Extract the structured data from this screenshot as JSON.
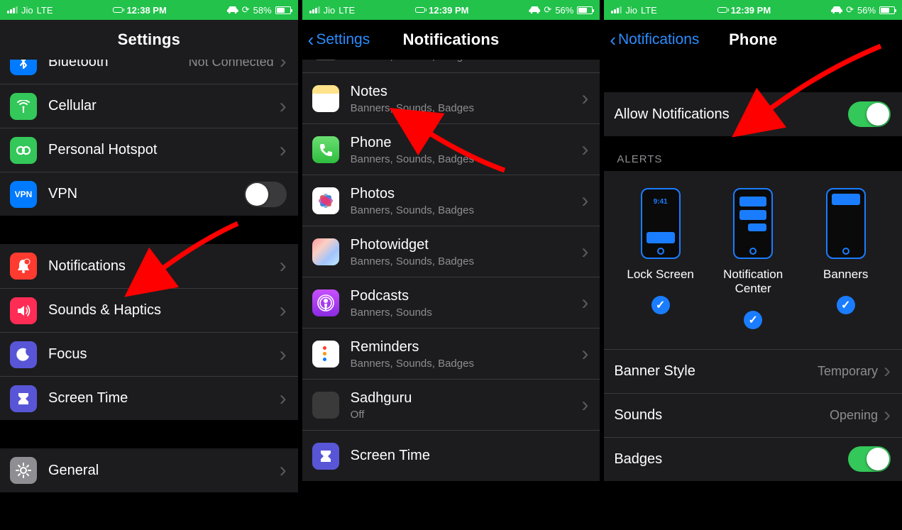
{
  "status": {
    "carrier": "Jio",
    "network": "LTE",
    "s1_time": "12:38 PM",
    "s1_batt": "58%",
    "s2_time": "12:39 PM",
    "s2_batt": "56%",
    "s3_time": "12:39 PM",
    "s3_batt": "56%"
  },
  "s1": {
    "title": "Settings",
    "rows": {
      "bluetooth": {
        "label": "Bluetooth",
        "value": "Not Connected"
      },
      "cellular": {
        "label": "Cellular"
      },
      "hotspot": {
        "label": "Personal Hotspot"
      },
      "vpn": {
        "label": "VPN"
      },
      "notifications": {
        "label": "Notifications"
      },
      "sounds": {
        "label": "Sounds & Haptics"
      },
      "focus": {
        "label": "Focus"
      },
      "screentime": {
        "label": "Screen Time"
      },
      "general": {
        "label": "General"
      }
    }
  },
  "s2": {
    "back": "Settings",
    "title": "Notifications",
    "sub_bsb": "Banners, Sounds, Badges",
    "sub_bs": "Banners, Sounds",
    "sub_off": "Off",
    "apps": {
      "notes": "Notes",
      "phone": "Phone",
      "photos": "Photos",
      "photowidget": "Photowidget",
      "podcasts": "Podcasts",
      "reminders": "Reminders",
      "sadhguru": "Sadhguru",
      "screentime": "Screen Time"
    }
  },
  "s3": {
    "back": "Notifications",
    "title": "Phone",
    "allow": "Allow Notifications",
    "alerts_header": "ALERTS",
    "alerts": {
      "lockscreen": "Lock Screen",
      "nc": "Notification Center",
      "banners": "Banners"
    },
    "banner_style": {
      "label": "Banner Style",
      "value": "Temporary"
    },
    "sounds": {
      "label": "Sounds",
      "value": "Opening"
    },
    "badges": {
      "label": "Badges"
    }
  }
}
